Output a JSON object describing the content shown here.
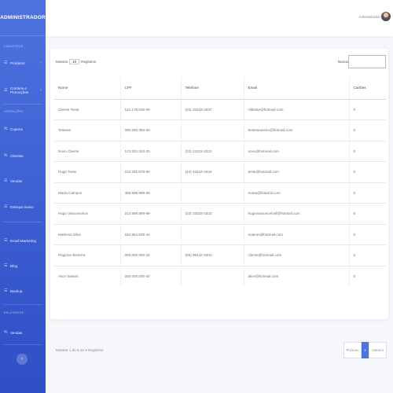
{
  "brand": "ADMINISTRADOR",
  "sidebar": {
    "sections": {
      "cadastros": "CADASTROS",
      "operacoes": "OPERAÇÕES",
      "relatorios": "RELATÓRIOS"
    },
    "items": {
      "produtos": "Produtos",
      "combos": "Combos e Promoções",
      "cupons": "Cupons",
      "clientes": "Clientes",
      "vendas": "Vendas",
      "estoque": "Estoque Baixo",
      "email": "Email Marketing",
      "blog": "Blog",
      "backup": "Backup",
      "rel_vendas": "Vendas"
    },
    "collapse_icon": "‹"
  },
  "topbar": {
    "user_name": "Administrador"
  },
  "table_controls": {
    "show_label": "Mostrar",
    "length_value": "10",
    "records_label": "Registros",
    "search_label": "Buscar"
  },
  "table": {
    "columns": [
      "Nome",
      "CPF",
      "Telefone",
      "Email",
      "Cartões"
    ],
    "rows": [
      [
        "Cliente Teste",
        "121.178.536-09",
        "(33) 33333-3337",
        "clibeste@hotmail.com",
        "0"
      ],
      [
        "Testeee",
        "090.283.356-00",
        "",
        "testeeeuseiro@hotmail.com",
        "0"
      ],
      [
        "Novo Cliente",
        "123.333.333-33",
        "(22) 22222-2222",
        "novo@hotmail.com",
        "0"
      ],
      [
        "Hugo Teste",
        "012.345.678-90",
        "(44) 44444-4444",
        "teste@hotmail.com",
        "0"
      ],
      [
        "Marta Campos",
        "456.999.999-99",
        "",
        "marta@hotamil.com",
        "0"
      ],
      [
        "Hugo Vasconcelos",
        "214.569.999-99",
        "(33) 33333-3333",
        "hugovasconcelosf@hotmail.com",
        "8"
      ],
      [
        "Matheus Silva",
        "184.854.545-44",
        "",
        "mateus@hotmail.com",
        "0"
      ],
      [
        "Reginon Bezerra",
        "000.000.000-18",
        "(85) 99142-3401",
        "cliente@hotmail.com",
        "2"
      ],
      [
        "Alice Santos",
        "000.000.000-40",
        "",
        "alice@hotmail.com",
        "0"
      ]
    ]
  },
  "footer": {
    "info": "Mostrar 1 de 9 de 9 Registros",
    "next": "Próximo",
    "page": "1",
    "prev": "Anterior"
  },
  "colors": {
    "sidebar": "#4e73df",
    "accent": "#4e73df"
  }
}
